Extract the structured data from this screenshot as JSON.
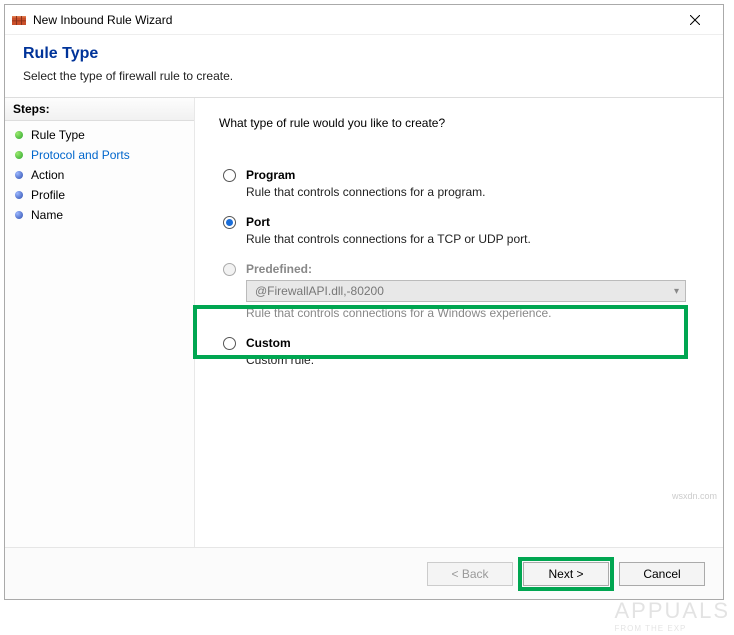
{
  "window": {
    "title": "New Inbound Rule Wizard"
  },
  "header": {
    "title": "Rule Type",
    "subtitle": "Select the type of firewall rule to create."
  },
  "steps": {
    "heading": "Steps:",
    "items": [
      {
        "label": "Rule Type",
        "bullet": "green",
        "active": false
      },
      {
        "label": "Protocol and Ports",
        "bullet": "green",
        "active": true
      },
      {
        "label": "Action",
        "bullet": "blue",
        "active": false
      },
      {
        "label": "Profile",
        "bullet": "blue",
        "active": false
      },
      {
        "label": "Name",
        "bullet": "blue",
        "active": false
      }
    ]
  },
  "content": {
    "question": "What type of rule would you like to create?",
    "options": {
      "program": {
        "label": "Program",
        "desc": "Rule that controls connections for a program."
      },
      "port": {
        "label": "Port",
        "desc": "Rule that controls connections for a TCP or UDP port."
      },
      "predefined": {
        "label": "Predefined:",
        "select_value": "@FirewallAPI.dll,-80200",
        "desc": "Rule that controls connections for a Windows experience."
      },
      "custom": {
        "label": "Custom",
        "desc": "Custom rule."
      }
    },
    "selected": "port"
  },
  "footer": {
    "back": "< Back",
    "next": "Next >",
    "cancel": "Cancel"
  },
  "watermark": {
    "brand": "APPUALS",
    "tag": "FROM THE EXP",
    "url": "wsxdn.com"
  }
}
